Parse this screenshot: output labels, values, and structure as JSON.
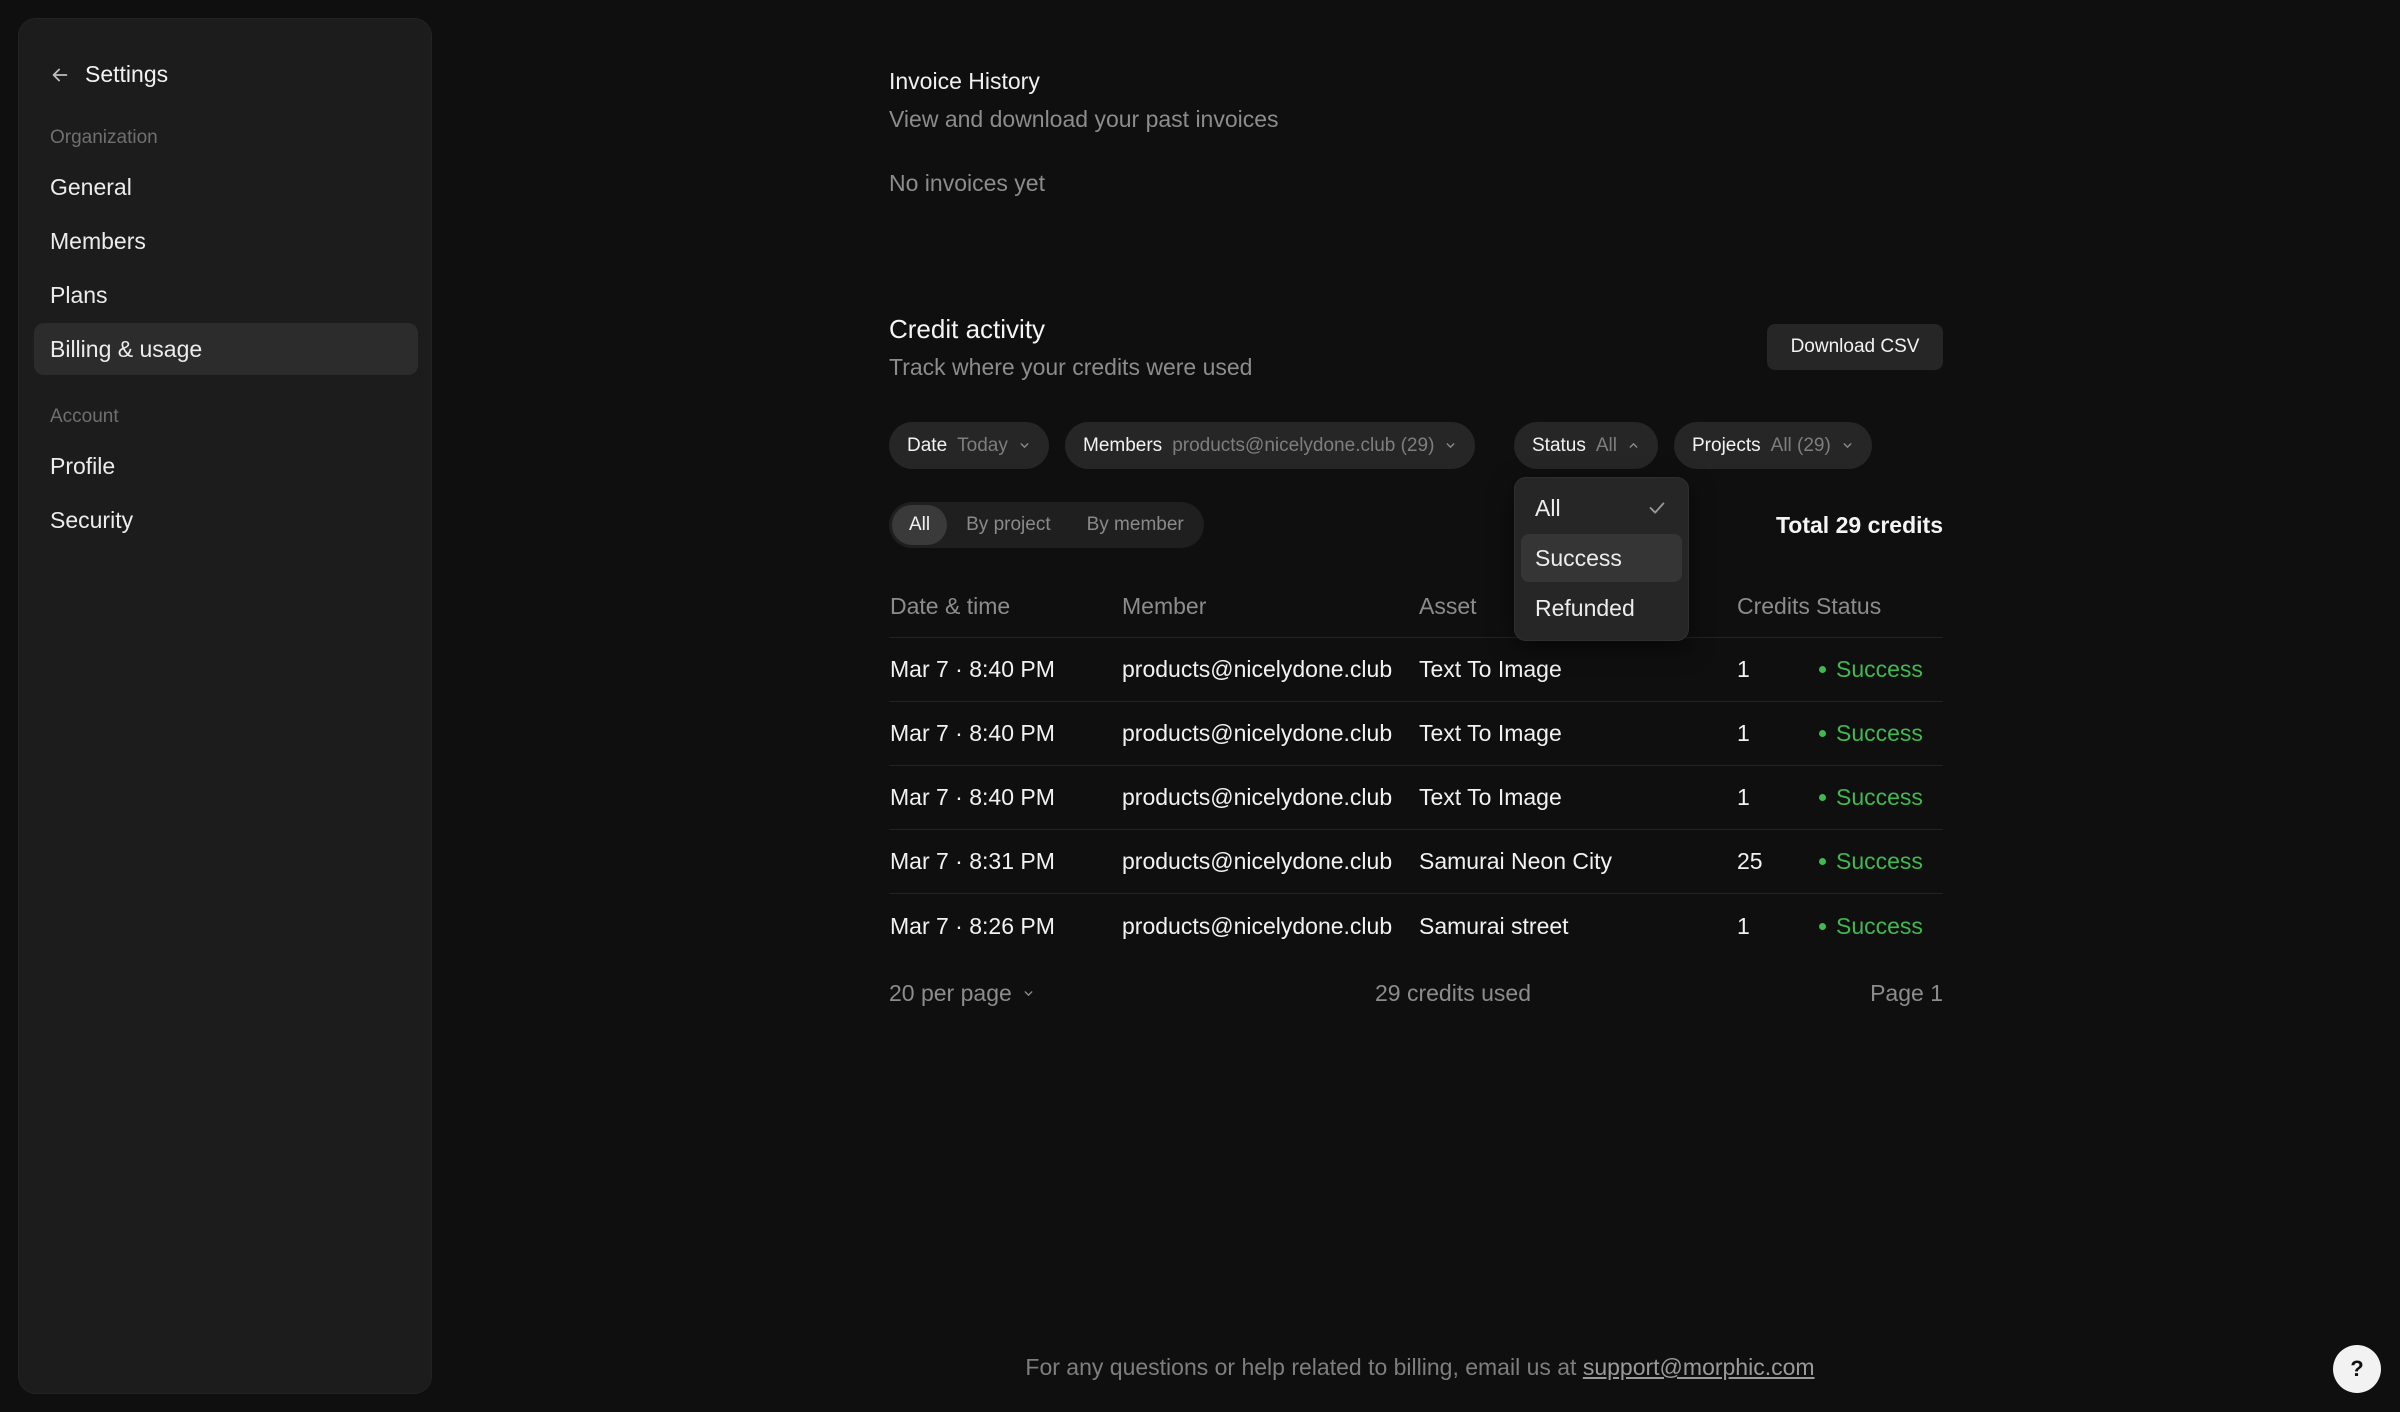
{
  "sidebar": {
    "title": "Settings",
    "org_section": "Organization",
    "account_section": "Account",
    "org_items": [
      {
        "label": "General"
      },
      {
        "label": "Members"
      },
      {
        "label": "Plans"
      },
      {
        "label": "Billing & usage",
        "active": true
      }
    ],
    "account_items": [
      {
        "label": "Profile"
      },
      {
        "label": "Security"
      }
    ]
  },
  "invoices": {
    "title": "Invoice History",
    "subtitle": "View and download your past invoices",
    "empty": "No invoices yet"
  },
  "credits": {
    "title": "Credit activity",
    "subtitle": "Track where your credits were used",
    "download_label": "Download CSV",
    "filters": {
      "date": {
        "key": "Date",
        "value": "Today"
      },
      "members": {
        "key": "Members",
        "value": "products@nicelydone.club (29)"
      },
      "status": {
        "key": "Status",
        "value": "All"
      },
      "projects": {
        "key": "Projects",
        "value": "All (29)"
      }
    },
    "view_tabs": [
      "All",
      "By project",
      "By member"
    ],
    "active_view": "All",
    "total": "Total 29 credits",
    "columns": [
      "Date & time",
      "Member",
      "Asset",
      "Credits",
      "Status"
    ],
    "rows": [
      {
        "date": "Mar 7 · 8:40 PM",
        "member": "products@nicelydone.club",
        "asset": "Text To Image",
        "credits": "1",
        "status": "Success"
      },
      {
        "date": "Mar 7 · 8:40 PM",
        "member": "products@nicelydone.club",
        "asset": "Text To Image",
        "credits": "1",
        "status": "Success"
      },
      {
        "date": "Mar 7 · 8:40 PM",
        "member": "products@nicelydone.club",
        "asset": "Text To Image",
        "credits": "1",
        "status": "Success"
      },
      {
        "date": "Mar 7 · 8:31 PM",
        "member": "products@nicelydone.club",
        "asset": "Samurai Neon City",
        "credits": "25",
        "status": "Success"
      },
      {
        "date": "Mar 7 · 8:26 PM",
        "member": "products@nicelydone.club",
        "asset": "Samurai street",
        "credits": "1",
        "status": "Success"
      }
    ],
    "per_page": "20 per page",
    "used": "29 credits used",
    "page": "Page 1",
    "status_dropdown": {
      "options": [
        "All",
        "Success",
        "Refunded"
      ],
      "selected": "All",
      "hovered": "Success"
    }
  },
  "footer": {
    "help_text": "For any questions or help related to billing, email us at",
    "email": "support@morphic.com",
    "help_button": "?"
  },
  "colors": {
    "background": "#0f0f0f",
    "sidebar": "#1c1c1c",
    "success": "#3fb950"
  }
}
